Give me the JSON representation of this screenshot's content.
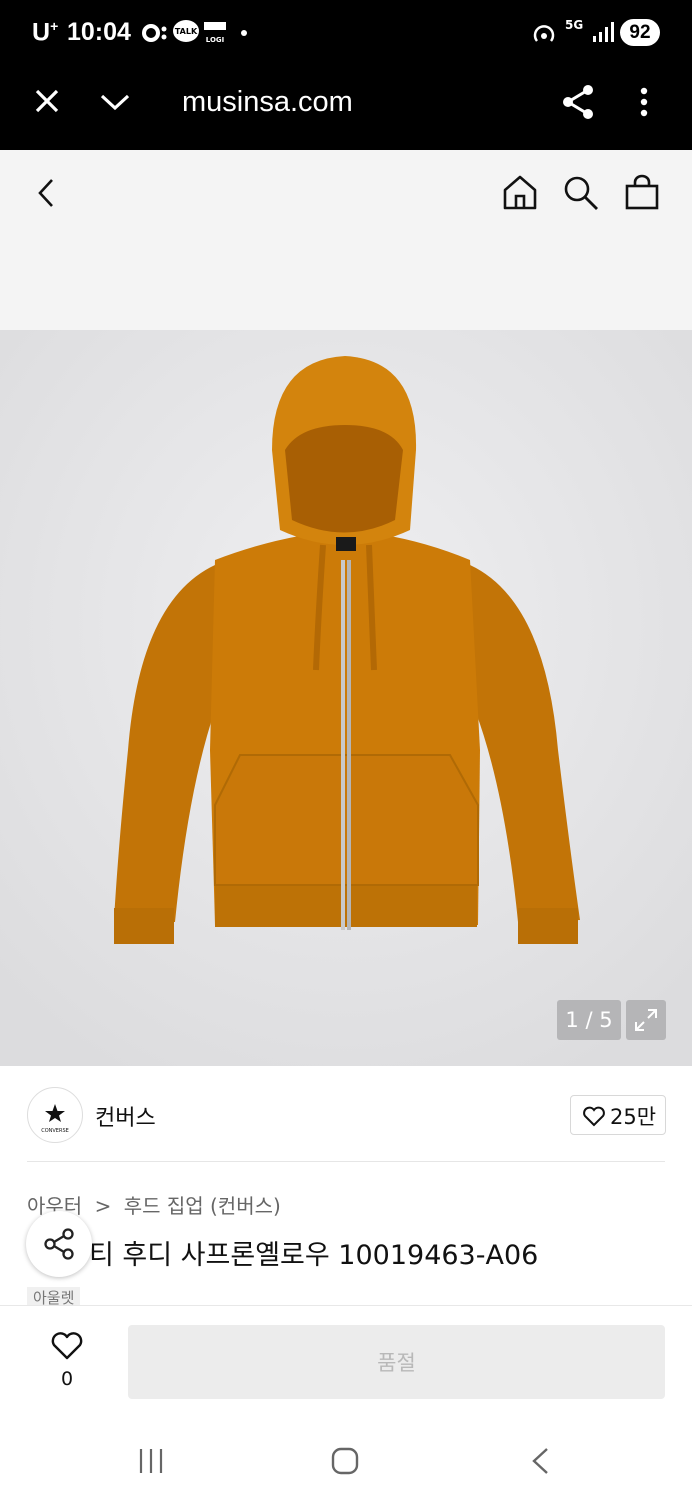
{
  "status": {
    "carrier": "U",
    "carrier_sup": "+",
    "time": "10:04",
    "talk": "TALK",
    "logi": "LOGI",
    "network": "5G",
    "battery": "92"
  },
  "browser": {
    "url": "musinsa.com"
  },
  "product": {
    "image_counter": "1 / 5",
    "brand": "컨버스",
    "brand_logo_text": "CONVERSE",
    "likes": "25만",
    "breadcrumb": [
      "아우터",
      "후드 집업 (컨버스)"
    ],
    "breadcrumb_sep": ">",
    "title": "티 후디 사프론옐로우 10019463-A06",
    "badge": "아울렛",
    "color": "#c97a0a"
  },
  "actions": {
    "wish_count": "0",
    "buy_label": "품절"
  },
  "icons": [
    "close-icon",
    "chevron-down-icon",
    "share-icon",
    "more-icon",
    "back-icon",
    "home-icon",
    "search-icon",
    "bag-icon",
    "expand-icon",
    "heart-icon",
    "recent-apps-icon",
    "home-nav-icon",
    "back-nav-icon"
  ]
}
